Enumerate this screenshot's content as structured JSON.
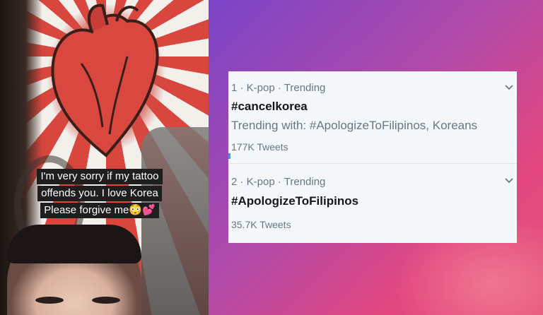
{
  "photo": {
    "caption_lines": [
      "I'm very sorry if my tattoo",
      "offends you. I love Korea",
      "Please forgive me😳💕"
    ]
  },
  "trends": [
    {
      "rank_line": "1 · K-pop · Trending",
      "hashtag": "#cancelkorea",
      "trending_with": "Trending with: #ApologizeToFilipinos, Koreans",
      "tweets": "177K Tweets"
    },
    {
      "rank_line": "2 · K-pop · Trending",
      "hashtag": "#ApologizeToFilipinos",
      "tweets": "35.7K Tweets"
    }
  ],
  "icons": {
    "more": "chevron-down-icon"
  },
  "colors": {
    "card_bg": "#f5f8fa",
    "meta_text": "#657786",
    "hashtag_text": "#14171a",
    "gradient_start": "#7a44c7",
    "gradient_end": "#e6527c"
  }
}
